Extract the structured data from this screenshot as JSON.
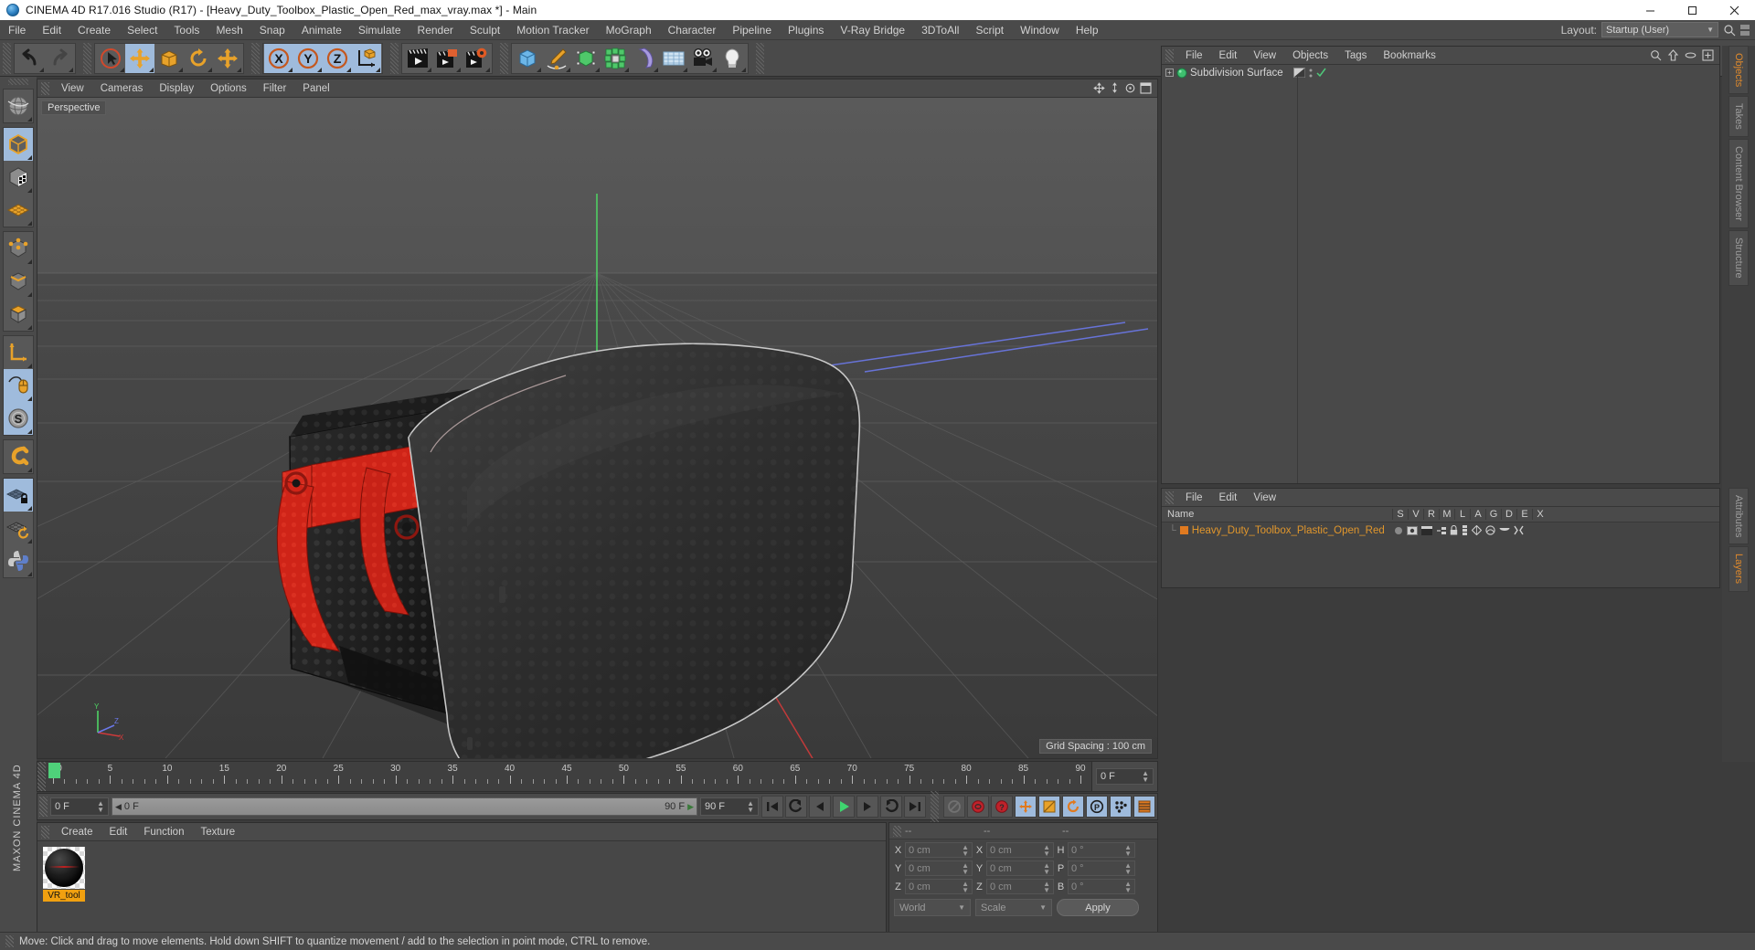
{
  "window": {
    "title": "CINEMA 4D R17.016 Studio (R17) - [Heavy_Duty_Toolbox_Plastic_Open_Red_max_vray.max *] - Main",
    "minimize": "–",
    "maximize": "❐",
    "close": "✕",
    "app_icon": "cinema4d-logo-icon"
  },
  "menubar": {
    "items": [
      "File",
      "Edit",
      "Create",
      "Select",
      "Tools",
      "Mesh",
      "Snap",
      "Animate",
      "Simulate",
      "Render",
      "Sculpt",
      "Motion Tracker",
      "MoGraph",
      "Character",
      "Pipeline",
      "Plugins",
      "V-Ray Bridge",
      "3DToAll",
      "Script",
      "Window",
      "Help"
    ],
    "layout_label": "Layout:",
    "layout_value": "Startup (User)"
  },
  "toolbar": {
    "groups": [
      {
        "buttons": [
          {
            "name": "undo-button",
            "icon": "undo-arrow-icon",
            "state": "normal"
          },
          {
            "name": "redo-button",
            "icon": "redo-arrow-icon",
            "state": "disabled"
          }
        ]
      },
      {
        "buttons": [
          {
            "name": "live-selection-tool",
            "icon": "cursor-circle-icon",
            "state": "normal"
          },
          {
            "name": "move-tool",
            "icon": "move-arrows-icon",
            "state": "selected"
          },
          {
            "name": "scale-tool",
            "icon": "scale-box-icon",
            "state": "normal"
          },
          {
            "name": "rotate-tool",
            "icon": "rotate-arc-icon",
            "state": "normal"
          },
          {
            "name": "move-duplicate-tool",
            "icon": "move-arrows-icon",
            "state": "normal"
          }
        ]
      },
      {
        "buttons": [
          {
            "name": "x-axis-lock",
            "icon": "axis-x-icon",
            "state": "selected"
          },
          {
            "name": "y-axis-lock",
            "icon": "axis-y-icon",
            "state": "selected"
          },
          {
            "name": "z-axis-lock",
            "icon": "axis-z-icon",
            "state": "selected"
          },
          {
            "name": "world-object-coordinate-toggle",
            "icon": "world-axis-cube-icon",
            "state": "selected"
          }
        ]
      },
      {
        "buttons": [
          {
            "name": "render-view-button",
            "icon": "render-clapboard-icon",
            "state": "normal"
          },
          {
            "name": "render-to-picture-viewer-button",
            "icon": "render-picture-icon",
            "state": "normal"
          },
          {
            "name": "render-settings-button",
            "icon": "render-gear-icon",
            "state": "normal"
          }
        ]
      },
      {
        "buttons": [
          {
            "name": "add-cube-object",
            "icon": "cube-icon",
            "state": "normal"
          },
          {
            "name": "add-spline-object",
            "icon": "pen-spline-icon",
            "state": "normal"
          },
          {
            "name": "add-generator-object",
            "icon": "nurbs-cube-icon",
            "state": "normal"
          },
          {
            "name": "add-array-object",
            "icon": "cloner-icon",
            "state": "normal"
          },
          {
            "name": "add-deformer-object",
            "icon": "bend-deformer-icon",
            "state": "normal"
          },
          {
            "name": "add-environment-object",
            "icon": "floor-grid-icon",
            "state": "normal"
          },
          {
            "name": "add-camera-object",
            "icon": "camera-icon",
            "state": "normal"
          },
          {
            "name": "add-light-object",
            "icon": "lightbulb-icon",
            "state": "normal"
          }
        ]
      }
    ]
  },
  "left_toolbar": {
    "groups": [
      [
        {
          "name": "undo-view-button",
          "icon": "globe-view-icon",
          "state": "normal"
        }
      ],
      [
        {
          "name": "model-mode-button",
          "icon": "model-cube-icon",
          "state": "selected"
        },
        {
          "name": "texture-mode-button",
          "icon": "texture-cube-icon",
          "state": "normal"
        },
        {
          "name": "workplane-mode-button",
          "icon": "workplane-grid-icon",
          "state": "normal"
        }
      ],
      [
        {
          "name": "points-mode-button",
          "icon": "points-cube-icon",
          "state": "normal"
        },
        {
          "name": "edges-mode-button",
          "icon": "edges-cube-icon",
          "state": "normal"
        },
        {
          "name": "polygons-mode-button",
          "icon": "polygons-cube-icon",
          "state": "normal"
        }
      ],
      [
        {
          "name": "object-axis-mode-button",
          "icon": "axis-l-icon",
          "state": "normal"
        },
        {
          "name": "enable-axis-modification-button",
          "icon": "mouse-axis-icon",
          "state": "selected"
        },
        {
          "name": "soft-selection-button",
          "icon": "soft-selection-s-icon",
          "state": "selected"
        }
      ],
      [
        {
          "name": "magnet-tool-button",
          "icon": "magnet-icon",
          "state": "normal"
        }
      ],
      [
        {
          "name": "lock-workplane-button",
          "icon": "workplane-lock-icon",
          "state": "selected"
        },
        {
          "name": "planar-workplane-button",
          "icon": "workplane-rotate-icon",
          "state": "normal"
        },
        {
          "name": "python-console-button",
          "icon": "python-icon",
          "state": "normal"
        }
      ]
    ],
    "brand": "MAXON CINEMA 4D"
  },
  "viewport": {
    "menus": [
      "View",
      "Cameras",
      "Display",
      "Options",
      "Filter",
      "Panel"
    ],
    "label": "Perspective",
    "grid_spacing": "Grid Spacing : 100 cm",
    "nav_icons": [
      "move-camera-icon",
      "scale-camera-icon",
      "rotate-camera-icon",
      "maximize-viewport-icon"
    ],
    "axis_labels": {
      "y": "Y",
      "x": "X",
      "z": "Z"
    }
  },
  "object_manager": {
    "menus": [
      "File",
      "Edit",
      "View",
      "Objects",
      "Tags",
      "Bookmarks"
    ],
    "header_icons": [
      "search-icon",
      "up-arrow-icon",
      "ellipse-icon",
      "plus-box-icon"
    ],
    "items": [
      {
        "name": "Subdivision Surface",
        "icon": "subdivision-surface-icon",
        "expand": "+",
        "tags": [
          "phong-tag",
          "visibility-dots",
          "check-mark"
        ]
      }
    ]
  },
  "layer_manager": {
    "menus": [
      "File",
      "Edit",
      "View"
    ],
    "columns": [
      "Name",
      "S",
      "V",
      "R",
      "M",
      "L",
      "A",
      "G",
      "D",
      "E",
      "X"
    ],
    "rows": [
      {
        "name": "Heavy_Duty_Toolbox_Plastic_Open_Red",
        "color": "#e07a20"
      }
    ]
  },
  "right_tabs": {
    "top": [
      "Objects",
      "Takes",
      "Content Browser",
      "Structure"
    ],
    "top_active": "Objects",
    "bottom": [
      "Attributes",
      "Layers"
    ],
    "bottom_active": "Layers"
  },
  "timeline": {
    "ticks": [
      {
        "label": "0",
        "value": 0
      },
      {
        "label": "5",
        "value": 5
      },
      {
        "label": "10",
        "value": 10
      },
      {
        "label": "15",
        "value": 15
      },
      {
        "label": "20",
        "value": 20
      },
      {
        "label": "25",
        "value": 25
      },
      {
        "label": "30",
        "value": 30
      },
      {
        "label": "35",
        "value": 35
      },
      {
        "label": "40",
        "value": 40
      },
      {
        "label": "45",
        "value": 45
      },
      {
        "label": "50",
        "value": 50
      },
      {
        "label": "55",
        "value": 55
      },
      {
        "label": "60",
        "value": 60
      },
      {
        "label": "65",
        "value": 65
      },
      {
        "label": "70",
        "value": 70
      },
      {
        "label": "75",
        "value": 75
      },
      {
        "label": "80",
        "value": 80
      },
      {
        "label": "85",
        "value": 85
      },
      {
        "label": "90",
        "value": 90
      }
    ],
    "range_min": 0,
    "range_max": 90,
    "current_frame_field": "0 F",
    "playhead_frame": "0 F"
  },
  "transport": {
    "current_frame": "0 F",
    "scrub_start": "0 F",
    "scrub_end": "90 F",
    "end_frame": "90 F",
    "buttons": [
      {
        "name": "go-to-start-button",
        "icon": "skip-start-icon",
        "state": "normal"
      },
      {
        "name": "step-back-keyframe-button",
        "icon": "prev-key-icon",
        "state": "normal"
      },
      {
        "name": "step-back-frame-button",
        "icon": "prev-frame-icon",
        "state": "normal"
      },
      {
        "name": "play-button",
        "icon": "play-icon",
        "state": "normal"
      },
      {
        "name": "step-forward-frame-button",
        "icon": "next-frame-icon",
        "state": "normal"
      },
      {
        "name": "step-forward-keyframe-button",
        "icon": "next-key-icon",
        "state": "normal"
      },
      {
        "name": "go-to-end-button",
        "icon": "skip-end-icon",
        "state": "normal"
      },
      {
        "name": "record-active-objects-button",
        "icon": "record-disabled-icon",
        "state": "disabled"
      },
      {
        "name": "autokeying-button",
        "icon": "autokey-red-icon",
        "state": "normal"
      },
      {
        "name": "keyframe-selection-button",
        "icon": "keyframe-question-icon",
        "state": "normal"
      },
      {
        "name": "position-key-button",
        "icon": "position-key-icon",
        "state": "selected"
      },
      {
        "name": "scale-key-button",
        "icon": "scale-key-icon",
        "state": "selected"
      },
      {
        "name": "rotation-key-button",
        "icon": "rotation-key-icon",
        "state": "selected"
      },
      {
        "name": "parameter-key-button",
        "icon": "param-key-icon",
        "state": "selected"
      },
      {
        "name": "point-level-animation-button",
        "icon": "pla-dots-icon",
        "state": "selected"
      },
      {
        "name": "timeline-window-button",
        "icon": "timeline-icon",
        "state": "selected"
      }
    ]
  },
  "material_manager": {
    "menus": [
      "Create",
      "Edit",
      "Function",
      "Texture"
    ],
    "materials": [
      {
        "name": "VR_tool",
        "preview": "dark-sphere-preview"
      }
    ]
  },
  "coordinates": {
    "headers": [
      "--",
      "--",
      "--"
    ],
    "rows": [
      {
        "pos_label": "X",
        "pos_value": "0 cm",
        "size_label": "X",
        "size_value": "0 cm",
        "rot_label": "H",
        "rot_value": "0 °"
      },
      {
        "pos_label": "Y",
        "pos_value": "0 cm",
        "size_label": "Y",
        "size_value": "0 cm",
        "rot_label": "P",
        "rot_value": "0 °"
      },
      {
        "pos_label": "Z",
        "pos_value": "0 cm",
        "size_label": "Z",
        "size_value": "0 cm",
        "rot_label": "B",
        "rot_value": "0 °"
      }
    ],
    "coordinate_system": "World",
    "size_mode": "Scale",
    "apply_label": "Apply"
  },
  "statusbar": {
    "message": "Move: Click and drag to move elements. Hold down SHIFT to quantize movement / add to the selection in point mode, CTRL to remove."
  },
  "colors": {
    "accent_orange": "#e08a2c",
    "selected_blue": "#9fbbdc",
    "panel_bg": "#4a4a4a",
    "viewport_bg": "#3b3b3b",
    "text": "#d4d4d4",
    "material_label": "#f0a010"
  }
}
